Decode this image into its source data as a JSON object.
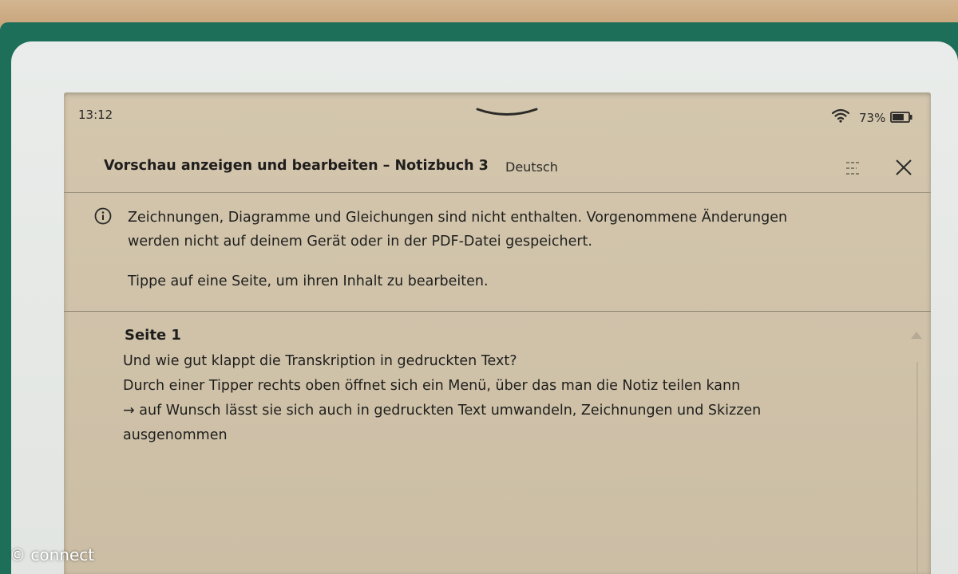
{
  "status_bar": {
    "time": "13:12",
    "battery_percent": "73%",
    "battery_level": 0.73
  },
  "header": {
    "title": "Vorschau anzeigen und bearbeiten – Notizbuch 3",
    "language": "Deutsch"
  },
  "notice": {
    "line1": "Zeichnungen, Diagramme und Gleichungen sind nicht enthalten. Vorgenommene Änderungen",
    "line2": "werden nicht auf deinem Gerät oder in der PDF-Datei gespeichert.",
    "tip": "Tippe auf eine Seite, um ihren Inhalt zu bearbeiten."
  },
  "page": {
    "label": "Seite 1",
    "lines": [
      "Und wie gut klappt die Transkription in gedruckten Text?",
      "Durch einer Tipper rechts oben öffnet sich ein Menü, über das man die Notiz teilen kann",
      "→ auf Wunsch lässt sie sich auch in gedruckten Text umwandeln, Zeichnungen und Skizzen",
      "ausgenommen"
    ]
  },
  "watermark": "© connect",
  "icons": [
    "pulldown-chevron-icon",
    "wifi-icon",
    "battery-icon",
    "menu-icon",
    "close-icon",
    "info-icon",
    "scroll-up-icon"
  ],
  "colors": {
    "screen": "#d0c3aa",
    "text": "#1f1e1c",
    "cover": "#1d6f5a"
  }
}
